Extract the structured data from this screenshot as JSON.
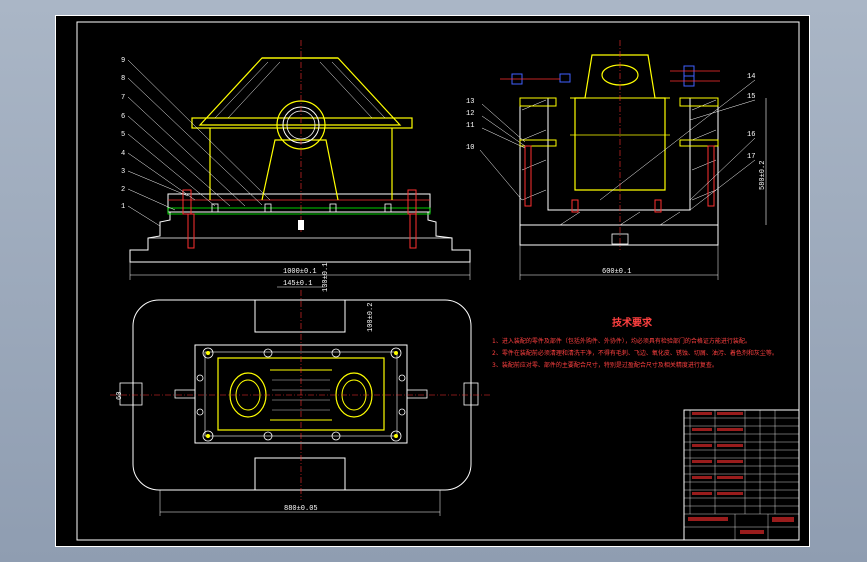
{
  "drawing": {
    "part_labels_left": [
      "9",
      "8",
      "7",
      "6",
      "5",
      "4",
      "3",
      "2",
      "1"
    ],
    "part_labels_right_left_side": [
      "13",
      "12",
      "11",
      "10"
    ],
    "part_labels_right_right_side": [
      "14",
      "15",
      "16",
      "17"
    ],
    "dim_front_width": "1000±0.1",
    "dim_side_width": "600±0.1",
    "dim_side_height": "580±0.2",
    "dim_top_width": "880±0.05",
    "dim_top_a": "145±0.1",
    "dim_top_b": "130±0.1",
    "dim_top_c": "100±0.2",
    "dim_top_slot": "60"
  },
  "technical_requirements": {
    "title": "技术要求",
    "lines": [
      "1、进入装配的零件及部件（包括外购件、外协件），均必须具有检验部门的合格证方能进行装配。",
      "2、零件在装配前必须清理和清洗干净，不得有毛刺、飞边、氧化皮、锈蚀、切屑、油污、着色剂和灰尘等。",
      "3、装配前应对零、部件的主要配合尺寸，特别是过盈配合尺寸及相关精度进行复查。"
    ]
  },
  "colors": {
    "part_yellow": "#ffff00",
    "line_white": "#ffffff",
    "line_red": "#ff3030",
    "line_cyan": "#00ffff",
    "line_blue": "#4060ff",
    "line_green": "#00ff00",
    "frame_bg": "#000000",
    "window_bg": "#a0aec0"
  }
}
